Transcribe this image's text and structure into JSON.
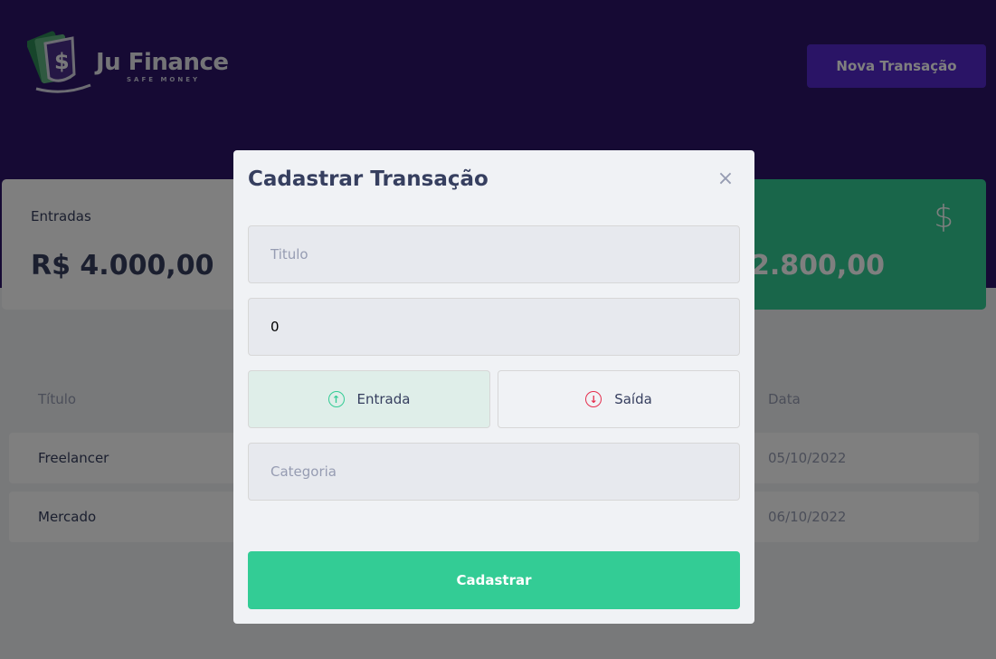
{
  "header": {
    "logo_text": "Ju Finance",
    "logo_sub": "SAFE MONEY",
    "new_button_label": "Nova Transação"
  },
  "summary": {
    "entradas_label": "Entradas",
    "entradas_value": "R$ 4.000,00",
    "total_value": "2.800,00",
    "total_icon": "dollar-icon"
  },
  "table": {
    "headers": {
      "titulo": "Título",
      "data": "Data"
    },
    "rows": [
      {
        "title": "Freelancer",
        "date": "05/10/2022"
      },
      {
        "title": "Mercado",
        "date": "06/10/2022"
      }
    ]
  },
  "modal": {
    "title": "Cadastrar Transação",
    "close_icon": "close-icon",
    "titulo_placeholder": "Titulo",
    "valor_value": "0",
    "entrada_label": "Entrada",
    "saida_label": "Saída",
    "categoria_placeholder": "Categoria",
    "submit_label": "Cadastrar"
  },
  "colors": {
    "header_bg": "#2d1468",
    "accent_purple": "#5429cc",
    "green": "#33cc95",
    "red": "#e52e4d"
  }
}
